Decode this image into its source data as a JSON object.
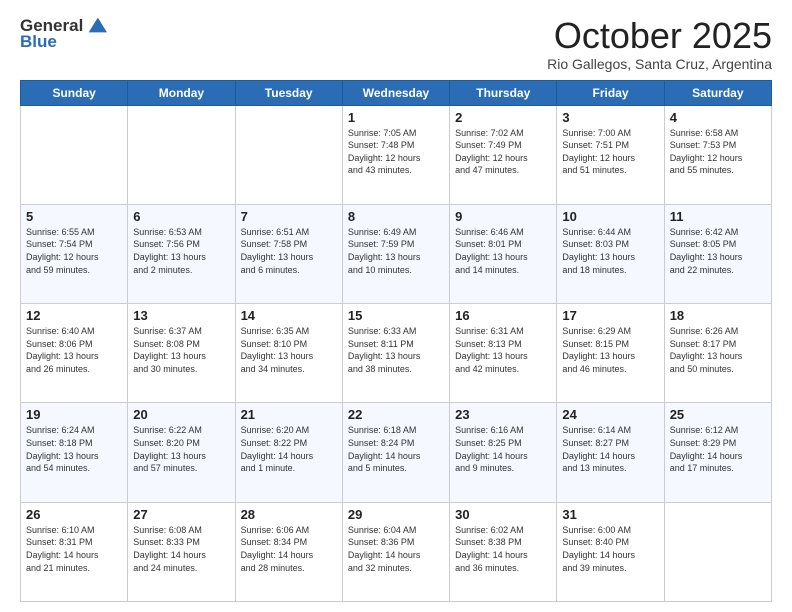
{
  "header": {
    "logo_line1": "General",
    "logo_line2": "Blue",
    "month": "October 2025",
    "location": "Rio Gallegos, Santa Cruz, Argentina"
  },
  "days_of_week": [
    "Sunday",
    "Monday",
    "Tuesday",
    "Wednesday",
    "Thursday",
    "Friday",
    "Saturday"
  ],
  "weeks": [
    [
      {
        "day": "",
        "info": ""
      },
      {
        "day": "",
        "info": ""
      },
      {
        "day": "",
        "info": ""
      },
      {
        "day": "1",
        "info": "Sunrise: 7:05 AM\nSunset: 7:48 PM\nDaylight: 12 hours\nand 43 minutes."
      },
      {
        "day": "2",
        "info": "Sunrise: 7:02 AM\nSunset: 7:49 PM\nDaylight: 12 hours\nand 47 minutes."
      },
      {
        "day": "3",
        "info": "Sunrise: 7:00 AM\nSunset: 7:51 PM\nDaylight: 12 hours\nand 51 minutes."
      },
      {
        "day": "4",
        "info": "Sunrise: 6:58 AM\nSunset: 7:53 PM\nDaylight: 12 hours\nand 55 minutes."
      }
    ],
    [
      {
        "day": "5",
        "info": "Sunrise: 6:55 AM\nSunset: 7:54 PM\nDaylight: 12 hours\nand 59 minutes."
      },
      {
        "day": "6",
        "info": "Sunrise: 6:53 AM\nSunset: 7:56 PM\nDaylight: 13 hours\nand 2 minutes."
      },
      {
        "day": "7",
        "info": "Sunrise: 6:51 AM\nSunset: 7:58 PM\nDaylight: 13 hours\nand 6 minutes."
      },
      {
        "day": "8",
        "info": "Sunrise: 6:49 AM\nSunset: 7:59 PM\nDaylight: 13 hours\nand 10 minutes."
      },
      {
        "day": "9",
        "info": "Sunrise: 6:46 AM\nSunset: 8:01 PM\nDaylight: 13 hours\nand 14 minutes."
      },
      {
        "day": "10",
        "info": "Sunrise: 6:44 AM\nSunset: 8:03 PM\nDaylight: 13 hours\nand 18 minutes."
      },
      {
        "day": "11",
        "info": "Sunrise: 6:42 AM\nSunset: 8:05 PM\nDaylight: 13 hours\nand 22 minutes."
      }
    ],
    [
      {
        "day": "12",
        "info": "Sunrise: 6:40 AM\nSunset: 8:06 PM\nDaylight: 13 hours\nand 26 minutes."
      },
      {
        "day": "13",
        "info": "Sunrise: 6:37 AM\nSunset: 8:08 PM\nDaylight: 13 hours\nand 30 minutes."
      },
      {
        "day": "14",
        "info": "Sunrise: 6:35 AM\nSunset: 8:10 PM\nDaylight: 13 hours\nand 34 minutes."
      },
      {
        "day": "15",
        "info": "Sunrise: 6:33 AM\nSunset: 8:11 PM\nDaylight: 13 hours\nand 38 minutes."
      },
      {
        "day": "16",
        "info": "Sunrise: 6:31 AM\nSunset: 8:13 PM\nDaylight: 13 hours\nand 42 minutes."
      },
      {
        "day": "17",
        "info": "Sunrise: 6:29 AM\nSunset: 8:15 PM\nDaylight: 13 hours\nand 46 minutes."
      },
      {
        "day": "18",
        "info": "Sunrise: 6:26 AM\nSunset: 8:17 PM\nDaylight: 13 hours\nand 50 minutes."
      }
    ],
    [
      {
        "day": "19",
        "info": "Sunrise: 6:24 AM\nSunset: 8:18 PM\nDaylight: 13 hours\nand 54 minutes."
      },
      {
        "day": "20",
        "info": "Sunrise: 6:22 AM\nSunset: 8:20 PM\nDaylight: 13 hours\nand 57 minutes."
      },
      {
        "day": "21",
        "info": "Sunrise: 6:20 AM\nSunset: 8:22 PM\nDaylight: 14 hours\nand 1 minute."
      },
      {
        "day": "22",
        "info": "Sunrise: 6:18 AM\nSunset: 8:24 PM\nDaylight: 14 hours\nand 5 minutes."
      },
      {
        "day": "23",
        "info": "Sunrise: 6:16 AM\nSunset: 8:25 PM\nDaylight: 14 hours\nand 9 minutes."
      },
      {
        "day": "24",
        "info": "Sunrise: 6:14 AM\nSunset: 8:27 PM\nDaylight: 14 hours\nand 13 minutes."
      },
      {
        "day": "25",
        "info": "Sunrise: 6:12 AM\nSunset: 8:29 PM\nDaylight: 14 hours\nand 17 minutes."
      }
    ],
    [
      {
        "day": "26",
        "info": "Sunrise: 6:10 AM\nSunset: 8:31 PM\nDaylight: 14 hours\nand 21 minutes."
      },
      {
        "day": "27",
        "info": "Sunrise: 6:08 AM\nSunset: 8:33 PM\nDaylight: 14 hours\nand 24 minutes."
      },
      {
        "day": "28",
        "info": "Sunrise: 6:06 AM\nSunset: 8:34 PM\nDaylight: 14 hours\nand 28 minutes."
      },
      {
        "day": "29",
        "info": "Sunrise: 6:04 AM\nSunset: 8:36 PM\nDaylight: 14 hours\nand 32 minutes."
      },
      {
        "day": "30",
        "info": "Sunrise: 6:02 AM\nSunset: 8:38 PM\nDaylight: 14 hours\nand 36 minutes."
      },
      {
        "day": "31",
        "info": "Sunrise: 6:00 AM\nSunset: 8:40 PM\nDaylight: 14 hours\nand 39 minutes."
      },
      {
        "day": "",
        "info": ""
      }
    ]
  ]
}
